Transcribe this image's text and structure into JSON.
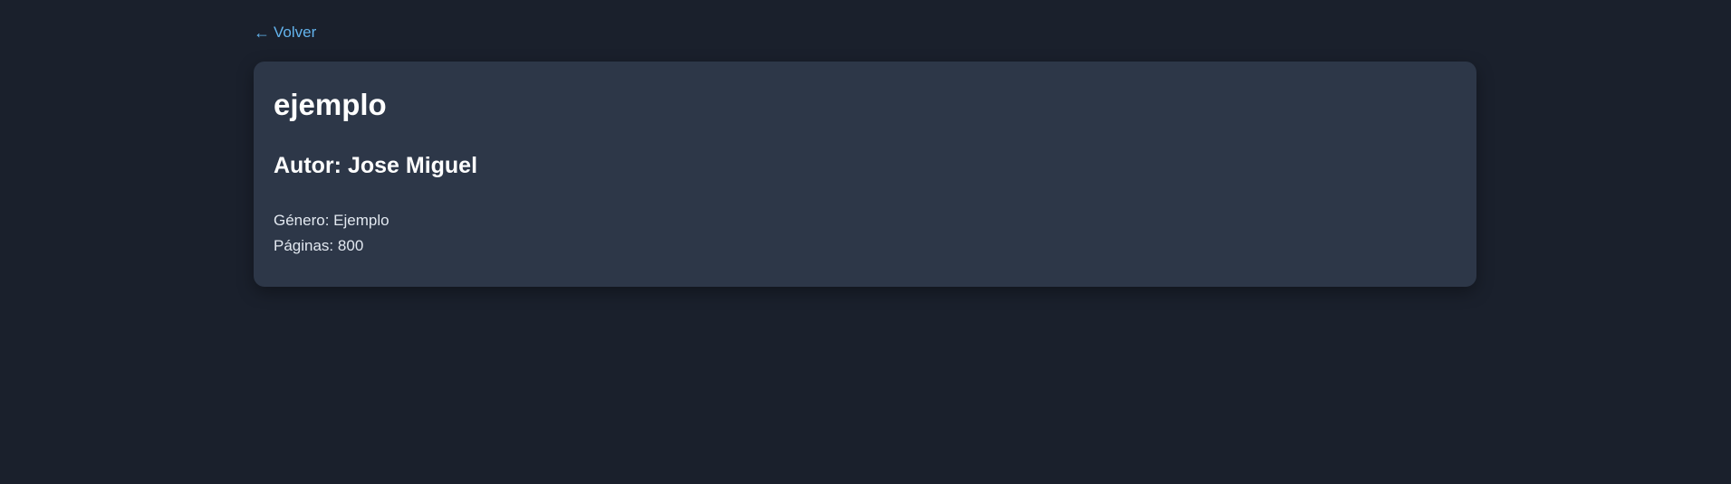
{
  "nav": {
    "back_arrow": "←",
    "back_label": "Volver"
  },
  "book": {
    "title": "ejemplo",
    "author_label": "Autor:",
    "author": "Jose Miguel",
    "genre_label": "Género:",
    "genre": "Ejemplo",
    "pages_label": "Páginas:",
    "pages": "800"
  },
  "colors": {
    "background": "#1a202c",
    "card": "#2d3748",
    "link": "#63b3ed",
    "text": "#ffffff"
  }
}
